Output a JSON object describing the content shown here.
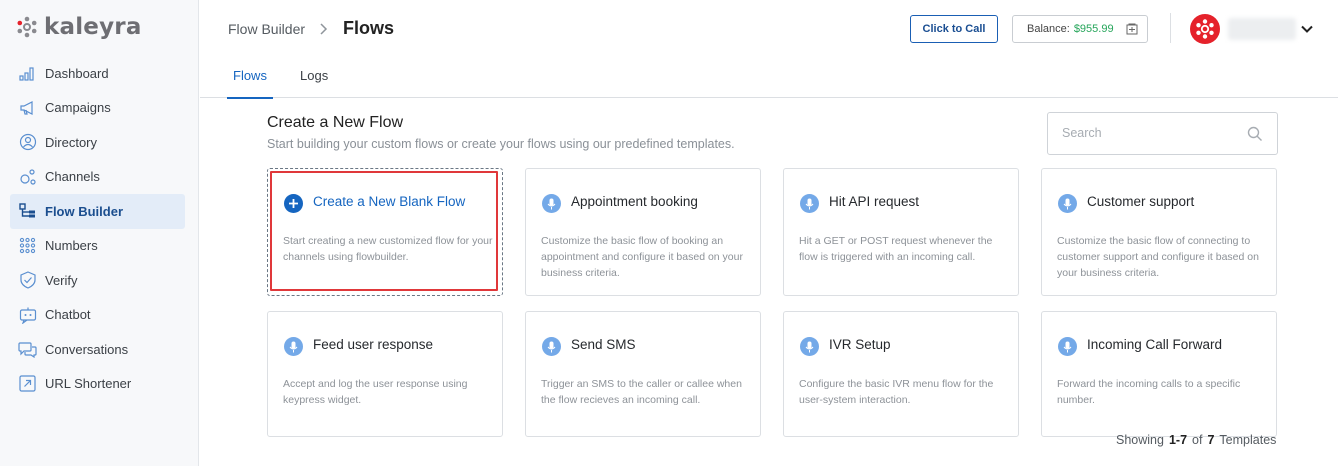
{
  "brand": {
    "name": "kaleyra",
    "color": "#e5222b"
  },
  "sidebar": {
    "items": [
      {
        "label": "Dashboard",
        "icon": "bar-chart-icon"
      },
      {
        "label": "Campaigns",
        "icon": "megaphone-icon"
      },
      {
        "label": "Directory",
        "icon": "contact-icon"
      },
      {
        "label": "Channels",
        "icon": "channels-icon"
      },
      {
        "label": "Flow Builder",
        "icon": "flow-icon",
        "active": true
      },
      {
        "label": "Numbers",
        "icon": "dial-pad-icon"
      },
      {
        "label": "Verify",
        "icon": "shield-check-icon"
      },
      {
        "label": "Chatbot",
        "icon": "chatbot-icon"
      },
      {
        "label": "Conversations",
        "icon": "chat-bubbles-icon"
      },
      {
        "label": "URL Shortener",
        "icon": "link-icon"
      }
    ]
  },
  "header": {
    "breadcrumb_parent": "Flow Builder",
    "breadcrumb_current": "Flows",
    "click_to_call": "Click to Call",
    "balance_label": "Balance:",
    "balance_amount": "$955.99"
  },
  "tabs": [
    {
      "label": "Flows",
      "active": true
    },
    {
      "label": "Logs",
      "active": false
    }
  ],
  "main": {
    "title": "Create a New Flow",
    "subtitle": "Start building your custom flows or create your flows using our predefined templates.",
    "search_placeholder": "Search",
    "cards": [
      {
        "title": "Create a New Blank Flow",
        "desc": "Start creating a new customized flow for your channels using flowbuilder.",
        "icon": "plus-icon"
      },
      {
        "title": "Appointment booking",
        "desc": "Customize the basic flow of booking an appointment and configure it based on your business criteria.",
        "icon": "microphone-icon"
      },
      {
        "title": "Hit API request",
        "desc": "Hit a GET or POST request whenever the flow is triggered with an incoming call.",
        "icon": "microphone-icon"
      },
      {
        "title": "Customer support",
        "desc": "Customize the basic flow of connecting to customer support and configure it based on your business criteria.",
        "icon": "microphone-icon"
      },
      {
        "title": "Feed user response",
        "desc": "Accept and log the user response using keypress widget.",
        "icon": "microphone-icon"
      },
      {
        "title": "Send SMS",
        "desc": "Trigger an SMS to the caller or callee when the flow recieves an incoming call.",
        "icon": "microphone-icon"
      },
      {
        "title": "IVR Setup",
        "desc": "Configure the basic IVR menu flow for the user-system interaction.",
        "icon": "microphone-icon"
      },
      {
        "title": "Incoming Call Forward",
        "desc": "Forward the incoming calls to a specific number.",
        "icon": "microphone-icon"
      }
    ],
    "showing": {
      "prefix": "Showing",
      "range": "1-7",
      "of": "of",
      "total": "7",
      "suffix": "Templates"
    }
  },
  "colors": {
    "accent": "#1565c0",
    "highlight": "#e0383a",
    "balance": "#25a55a"
  }
}
